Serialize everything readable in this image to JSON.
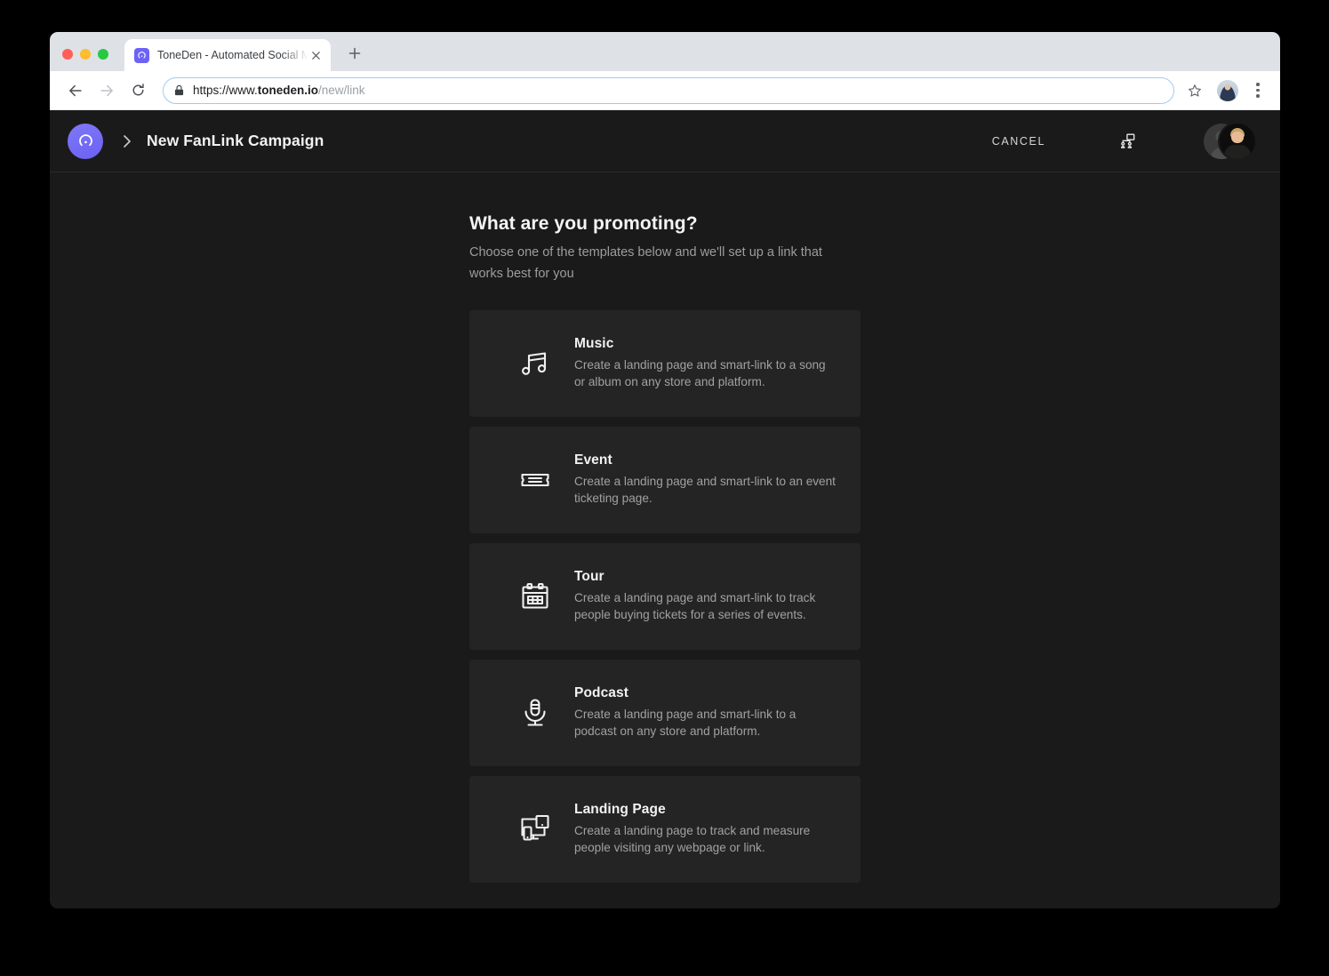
{
  "browser": {
    "tab": {
      "title": "ToneDen - Automated Social M",
      "favicon_icon": "toneden-logo-icon",
      "close_icon": "close-icon"
    },
    "new_tab_icon": "plus-icon",
    "back_icon": "arrow-back-icon",
    "forward_icon": "arrow-forward-icon",
    "reload_icon": "reload-icon",
    "lock_icon": "lock-icon",
    "url": {
      "scheme": "https://www.",
      "domain": "toneden.io",
      "path": "/new/link",
      "full": "https://www.toneden.io/new/link"
    },
    "star_icon": "star-icon",
    "profile_icon": "browser-profile-avatar",
    "menu_icon": "kebab-menu-icon"
  },
  "app": {
    "header": {
      "logo_icon": "toneden-logo-icon",
      "breadcrumb_separator_icon": "chevron-right-icon",
      "title": "New FanLink Campaign",
      "cancel_label": "CANCEL",
      "team_icon": "team-org-chart-icon",
      "avatar_placeholder_icon": "person-placeholder-avatar",
      "avatar_user_icon": "user-photo-avatar"
    },
    "main": {
      "title": "What are you promoting?",
      "subtitle": "Choose one of the templates below and we'll set up a link that works best for you",
      "templates": [
        {
          "icon": "music-note-icon",
          "title": "Music",
          "description": "Create a landing page and smart-link to a song or album on any store and platform."
        },
        {
          "icon": "ticket-icon",
          "title": "Event",
          "description": "Create a landing page and smart-link to an event ticketing page."
        },
        {
          "icon": "calendar-icon",
          "title": "Tour",
          "description": "Create a landing page and smart-link to track people buying tickets for a series of events."
        },
        {
          "icon": "microphone-icon",
          "title": "Podcast",
          "description": "Create a landing page and smart-link to a podcast on any store and platform."
        },
        {
          "icon": "devices-monitor-icon",
          "title": "Landing Page",
          "description": "Create a landing page to track and measure people visiting any webpage or link."
        }
      ]
    }
  },
  "colors": {
    "page_background": "#1a1a1a",
    "card_background": "#242424",
    "brand_purple": "#6c63f5",
    "text_primary": "#f2f2f2",
    "text_secondary": "#a1a1a1"
  }
}
